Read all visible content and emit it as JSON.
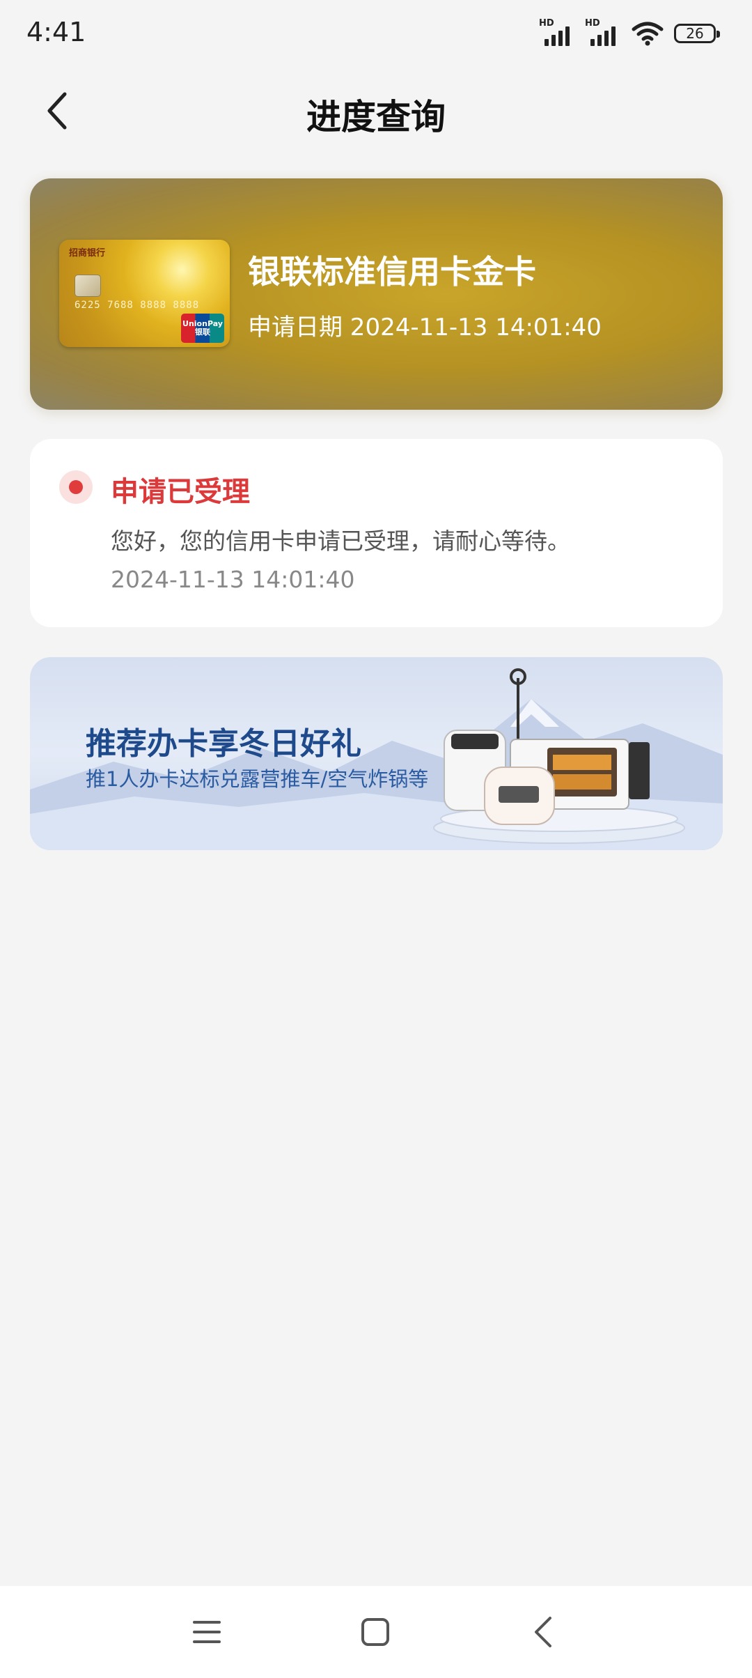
{
  "status_bar": {
    "time": "4:41",
    "signal_1_label": "HD",
    "signal_2_label": "HD",
    "battery_level": "26"
  },
  "header": {
    "title": "进度查询",
    "back_icon": "chevron-left-icon"
  },
  "card": {
    "name": "银联标准信用卡金卡",
    "apply_date": "申请日期 2024-11-13 14:01:40",
    "image": {
      "bank_label": "招商银行",
      "number": "6225 7688 8888 8888",
      "network_label": "UnionPay 银联"
    }
  },
  "application_status": {
    "title": "申请已受理",
    "description": "您好，您的信用卡申请已受理，请耐心等待。",
    "timestamp": "2024-11-13 14:01:40",
    "accent_color": "#dc3a3a"
  },
  "promo": {
    "title": "推荐办卡享冬日好礼",
    "subtitle": "推1人办卡达标兑露营推车/空气炸锅等"
  },
  "nav_bar": {
    "menu_icon": "menu-icon",
    "home_icon": "home-square-icon",
    "back_icon": "back-chevron-icon"
  }
}
